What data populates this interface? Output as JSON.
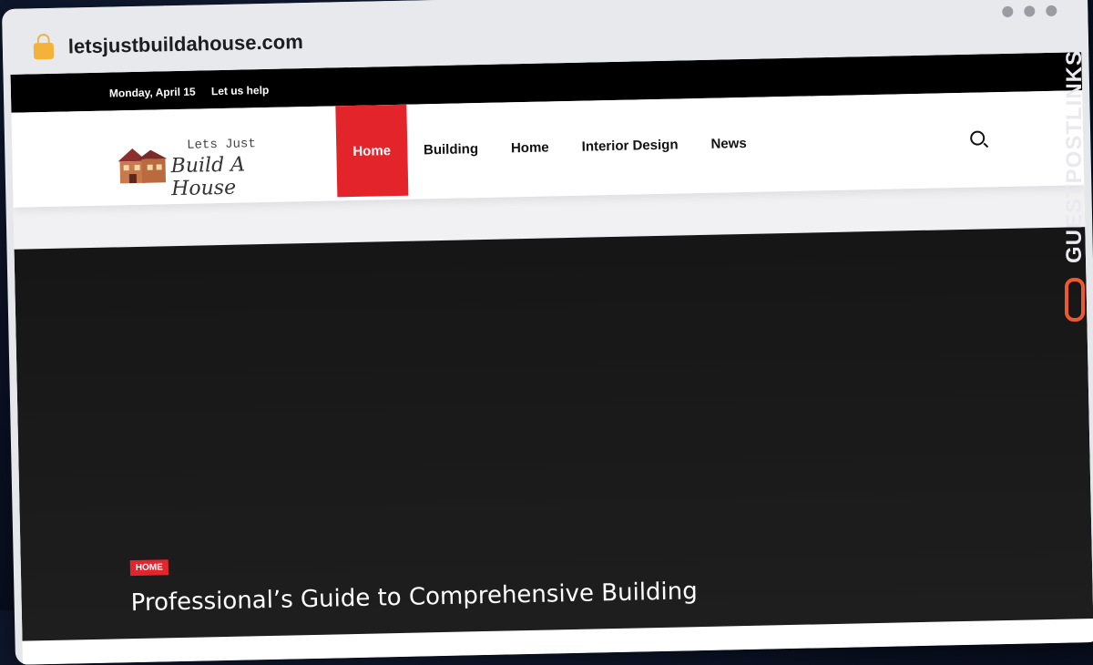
{
  "browser": {
    "url": "letsjustbuildahouse.com"
  },
  "topbar": {
    "date": "Monday, April 15",
    "help": "Let us help"
  },
  "logo": {
    "line1": "Lets Just",
    "line2": "Build A House"
  },
  "nav": {
    "items": [
      "Home",
      "Building",
      "Home",
      "Interior Design",
      "News"
    ]
  },
  "hero": {
    "category": "HOME",
    "title": "Professional’s Guide to Comprehensive Building"
  },
  "watermark": {
    "text": "GUESTPOSTLINKS"
  },
  "colors": {
    "accent": "#e3242b",
    "topbar": "#000000",
    "hero": "#1a1a1a",
    "watermark": "#ef5a2d"
  }
}
